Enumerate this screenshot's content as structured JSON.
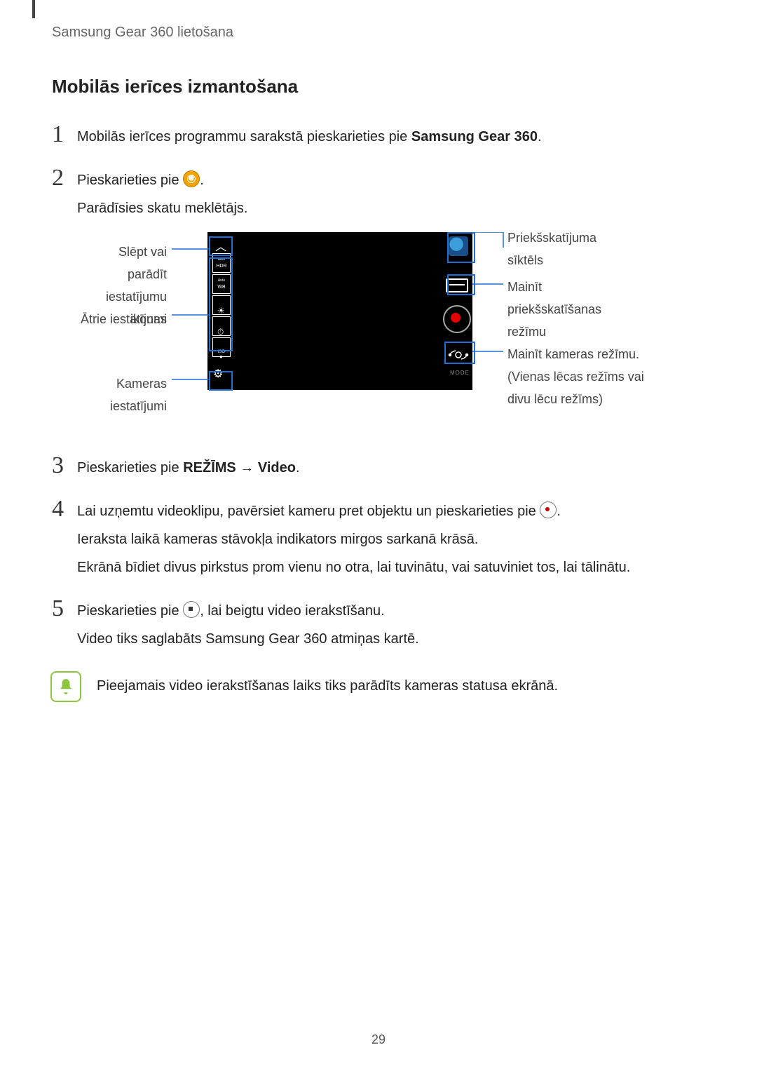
{
  "running_head": "Samsung Gear 360 lietošana",
  "section_title": "Mobilās ierīces izmantošana",
  "steps": {
    "1": {
      "num": "1",
      "a": "Mobilās ierīces programmu sarakstā pieskarieties pie ",
      "b": "Samsung Gear 360",
      "c": "."
    },
    "2": {
      "num": "2",
      "a": "Pieskarieties pie ",
      "b": ".",
      "sub": "Parādīsies skatu meklētājs."
    },
    "3": {
      "num": "3",
      "a": "Pieskarieties pie ",
      "b": "REŽĪMS",
      "arrow": " → ",
      "c": "Video",
      "d": "."
    },
    "4": {
      "num": "4",
      "a": "Lai uzņemtu videoklipu, pavērsiet kameru pret objektu un pieskarieties pie ",
      "b": ".",
      "p2": "Ieraksta laikā kameras stāvokļa indikators mirgos sarkanā krāsā.",
      "p3": "Ekrānā bīdiet divus pirkstus prom vienu no otra, lai tuvinātu, vai satuviniet tos, lai tālinātu."
    },
    "5": {
      "num": "5",
      "a": "Pieskarieties pie ",
      "b": ", lai beigtu video ierakstīšanu.",
      "p2": "Video tiks saglabāts Samsung Gear 360 atmiņas kartē."
    }
  },
  "callouts": {
    "collapse": "Slēpt vai parādīt iestatījumu ikonas",
    "quick": "Ātrie iestatījumi",
    "settings": "Kameras iestatījumi",
    "thumb": "Priekšskatījuma sīktēls",
    "view": "Mainīt priekšskatīšanas režīmu",
    "switch": "Mainīt kameras režīmu. (Vienas lēcas režīms vai divu lēcu režīms)"
  },
  "quick_icons": {
    "hdr": "HDR",
    "wb": "WB",
    "iso": "ISO"
  },
  "mode_word": "MODE",
  "note": "Pieejamais video ierakstīšanas laiks tiks parādīts kameras statusa ekrānā.",
  "page_number": "29"
}
